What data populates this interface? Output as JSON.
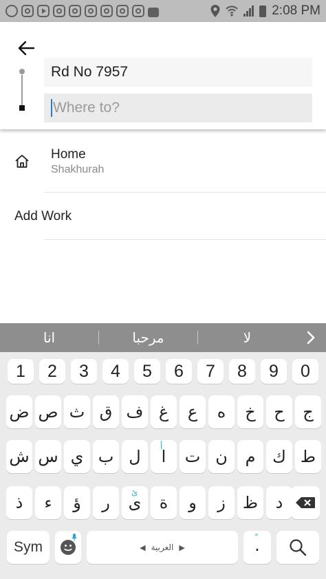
{
  "status_bar": {
    "time": "2:08 PM",
    "notification_icons": [
      "whatsapp-icon",
      "instagram-icon",
      "youtube-icon",
      "instagram-icon",
      "instagram-icon",
      "instagram-icon",
      "instagram-icon",
      "instagram-icon",
      "instagram-icon",
      "bag-icon"
    ],
    "system_icons": [
      "location-icon",
      "wifi-calling-icon",
      "signal-icon",
      "battery-icon"
    ]
  },
  "header": {
    "pickup_value": "Rd No 7957",
    "destination_placeholder": "Where to?"
  },
  "places": {
    "home": {
      "title": "Home",
      "subtitle": "Shakhurah"
    },
    "work": {
      "label": "Add Work"
    }
  },
  "keyboard": {
    "suggestions": [
      "انا",
      "مرحبا",
      "لا"
    ],
    "row_numbers": [
      "1",
      "2",
      "3",
      "4",
      "5",
      "6",
      "7",
      "8",
      "9",
      "0"
    ],
    "row1": [
      "ض",
      "ص",
      "ث",
      "ق",
      "ف",
      "غ",
      "ع",
      "ه",
      "خ",
      "ح",
      "ج"
    ],
    "row2": [
      "ش",
      "س",
      "ي",
      "ب",
      "ل",
      "ا",
      "ت",
      "ن",
      "م",
      "ك",
      "ط"
    ],
    "row3": [
      "ذ",
      "ء",
      "ؤ",
      "ر",
      "ى",
      "ة",
      "و",
      "ز",
      "ظ",
      "د"
    ],
    "hints": {
      "alef": "أ",
      "alef_maksura": "ئ"
    },
    "sym_label": "Sym",
    "space_label": "العربية",
    "dot_label": ".",
    "dot_hint": "ّ"
  },
  "colors": {
    "status_bar_bg": "#bdbdbd",
    "suggestion_bar_bg": "#8e8e8e",
    "keyboard_bg": "#ebebeb",
    "caret": "#2b7bbf",
    "accent_hint": "#2aa7cf"
  }
}
